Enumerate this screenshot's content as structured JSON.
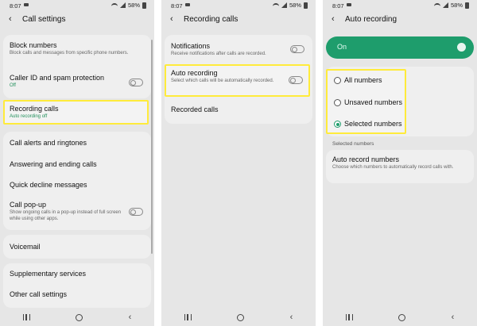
{
  "status_bar": {
    "time": "8:07",
    "battery": "58%"
  },
  "panel1": {
    "title": "Call settings",
    "items": {
      "block_numbers": {
        "label": "Block numbers",
        "sub": "Block calls and messages from specific phone numbers."
      },
      "caller_id": {
        "label": "Caller ID and spam protection",
        "sub": "Off"
      },
      "recording_calls": {
        "label": "Recording calls",
        "sub": "Auto recording off"
      },
      "call_alerts": {
        "label": "Call alerts and ringtones"
      },
      "answering_ending": {
        "label": "Answering and ending calls"
      },
      "quick_decline": {
        "label": "Quick decline messages"
      },
      "call_popup": {
        "label": "Call pop-up",
        "sub": "Show ongoing calls in a pop-up instead of full screen while using other apps."
      },
      "voicemail": {
        "label": "Voicemail"
      },
      "supplementary": {
        "label": "Supplementary services"
      },
      "other": {
        "label": "Other call settings"
      }
    }
  },
  "panel2": {
    "title": "Recording calls",
    "items": {
      "notifications": {
        "label": "Notifications",
        "sub": "Receive notifications after calls are recorded."
      },
      "auto_recording": {
        "label": "Auto recording",
        "sub": "Select which calls will be automatically recorded."
      },
      "recorded_calls": {
        "label": "Recorded calls"
      }
    }
  },
  "panel3": {
    "title": "Auto recording",
    "on_label": "On",
    "options": {
      "all": "All numbers",
      "unsaved": "Unsaved numbers",
      "selected": "Selected numbers"
    },
    "selected_option": "Selected numbers",
    "section_label": "Selected numbers",
    "auto_record_numbers": {
      "label": "Auto record numbers",
      "sub": "Choose which numbers to automatically record calls with."
    }
  },
  "colors": {
    "accent_green": "#1e9d6c",
    "highlight_yellow": "#ffeb3b",
    "background": "#e6e6e6"
  },
  "icons": [
    "back-arrow-icon",
    "recents-icon",
    "home-icon",
    "nav-back-icon",
    "wifi-icon",
    "signal-icon",
    "battery-icon",
    "camera-icon"
  ]
}
